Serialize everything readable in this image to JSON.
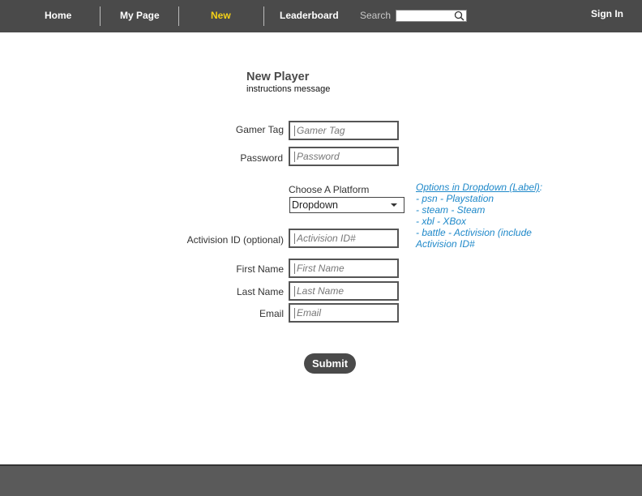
{
  "nav": {
    "home": "Home",
    "my_page": "My Page",
    "new": "New",
    "leaderboard": "Leaderboard",
    "search_label": "Search",
    "search_value": "",
    "sign_in": "Sign In"
  },
  "form": {
    "title": "New Player",
    "instructions": "instructions message",
    "gamer_tag_label": "Gamer Tag",
    "gamer_tag_placeholder": "Gamer Tag",
    "password_label": "Password",
    "password_placeholder": "Password",
    "platform_label": "Choose A Platform",
    "platform_value": "Dropdown",
    "activision_label": "Activision ID (optional)",
    "activision_placeholder": "Activision ID#",
    "first_name_label": "First Name",
    "first_name_placeholder": "First Name",
    "last_name_label": "Last Name",
    "last_name_placeholder": "Last Name",
    "email_label": "Email",
    "email_placeholder": "Email",
    "submit_label": "Submit"
  },
  "annotation": {
    "heading": "Options in Dropdown (Label)",
    "heading_suffix": ":",
    "lines": [
      "- psn - Playstation",
      "- steam - Steam",
      "- xbl - XBox",
      "- battle - Activision (include Activision ID#"
    ]
  },
  "colors": {
    "topbar": "#4a4a4a",
    "active_nav": "#f5d117",
    "annotation": "#1e88c9",
    "footer": "#5a5a5a"
  }
}
